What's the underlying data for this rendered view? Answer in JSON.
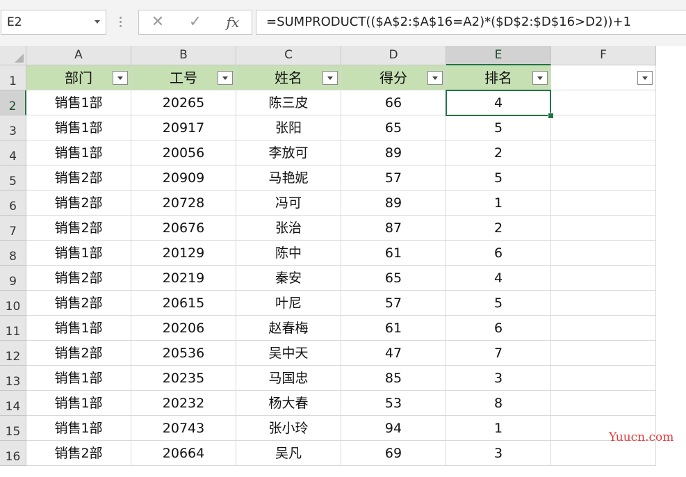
{
  "formula_bar": {
    "name_box": "E2",
    "formula": "=SUMPRODUCT(($A$2:$A$16=A2)*($D$2:$D$16>D2))+1",
    "cancel_glyph": "✕",
    "enter_glyph": "✓",
    "fx_label": "fx"
  },
  "columns": [
    "A",
    "B",
    "C",
    "D",
    "E",
    "F"
  ],
  "rows": [
    "1",
    "2",
    "3",
    "4",
    "5",
    "6",
    "7",
    "8",
    "9",
    "10",
    "11",
    "12",
    "13",
    "14",
    "15",
    "16"
  ],
  "table": {
    "headers": [
      "部门",
      "工号",
      "姓名",
      "得分",
      "排名"
    ],
    "data": [
      [
        "销售1部",
        "20265",
        "陈三皮",
        "66",
        "4"
      ],
      [
        "销售1部",
        "20917",
        "张阳",
        "65",
        "5"
      ],
      [
        "销售1部",
        "20056",
        "李放可",
        "89",
        "2"
      ],
      [
        "销售2部",
        "20909",
        "马艳妮",
        "57",
        "5"
      ],
      [
        "销售2部",
        "20728",
        "冯可",
        "89",
        "1"
      ],
      [
        "销售2部",
        "20676",
        "张治",
        "87",
        "2"
      ],
      [
        "销售1部",
        "20129",
        "陈中",
        "61",
        "6"
      ],
      [
        "销售2部",
        "20219",
        "秦安",
        "65",
        "4"
      ],
      [
        "销售2部",
        "20615",
        "叶尼",
        "57",
        "5"
      ],
      [
        "销售1部",
        "20206",
        "赵春梅",
        "61",
        "6"
      ],
      [
        "销售2部",
        "20536",
        "吴中天",
        "47",
        "7"
      ],
      [
        "销售1部",
        "20235",
        "马国忠",
        "85",
        "3"
      ],
      [
        "销售1部",
        "20232",
        "杨大春",
        "53",
        "8"
      ],
      [
        "销售1部",
        "20743",
        "张小玲",
        "94",
        "1"
      ],
      [
        "销售2部",
        "20664",
        "吴凡",
        "69",
        "3"
      ]
    ]
  },
  "selected_cell": "E2",
  "watermark": "Yuucn.com",
  "colors": {
    "header_fill": "#c6e0b4",
    "selection": "#217346",
    "watermark": "#e03a3a"
  }
}
